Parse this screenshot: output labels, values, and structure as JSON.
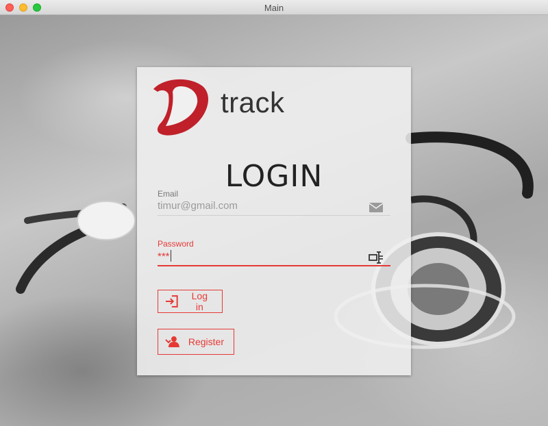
{
  "window": {
    "title": "Main"
  },
  "brand": {
    "name": "track"
  },
  "login": {
    "heading": "LOGIN",
    "email": {
      "label": "Email",
      "value": "timur@gmail.com"
    },
    "password": {
      "label": "Password",
      "value": "***"
    },
    "login_button": "Log in",
    "register_button": "Register"
  },
  "colors": {
    "accent": "#e53935",
    "logo": "#c0202a"
  },
  "icons": {
    "email": "envelope-icon",
    "password": "text-cursor-icon",
    "login": "login-arrow-icon",
    "register": "user-add-icon"
  }
}
